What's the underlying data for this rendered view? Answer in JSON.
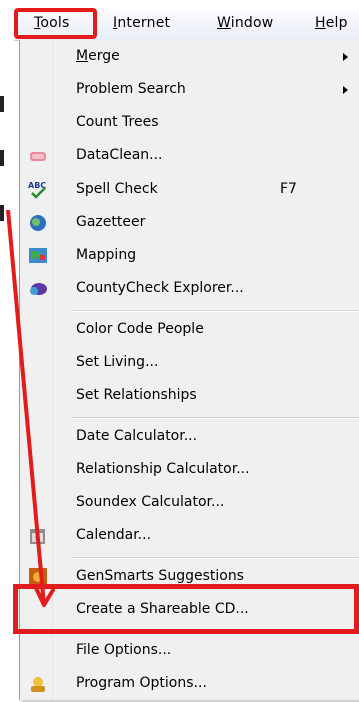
{
  "menubar": {
    "items": [
      {
        "label": "Tools",
        "accel": "T",
        "rest": "ools"
      },
      {
        "label": "Internet",
        "accel": "I",
        "rest": "nternet"
      },
      {
        "label": "Window",
        "accel": "W",
        "rest": "indow"
      },
      {
        "label": "Help",
        "accel": "H",
        "rest": "elp"
      }
    ]
  },
  "tools_menu": {
    "items": [
      {
        "label": "Merge",
        "accel": "M",
        "rest": "erge",
        "submenu": true
      },
      {
        "label": "Problem Search",
        "submenu": true
      },
      {
        "label": "Count Trees"
      },
      {
        "label": "DataClean...",
        "icon": "dataclean-icon"
      },
      {
        "label": "Spell Check",
        "shortcut": "F7",
        "icon": "spell-check-icon"
      },
      {
        "label": "Gazetteer",
        "icon": "gazetteer-icon"
      },
      {
        "label": "Mapping",
        "icon": "mapping-icon"
      },
      {
        "label": "CountyCheck Explorer...",
        "icon": "countycheck-icon"
      },
      {
        "label": "Color Code People"
      },
      {
        "label": "Set Living..."
      },
      {
        "label": "Set Relationships"
      },
      {
        "label": "Date Calculator..."
      },
      {
        "label": "Relationship Calculator..."
      },
      {
        "label": "Soundex Calculator..."
      },
      {
        "label": "Calendar...",
        "icon": "calendar-icon"
      },
      {
        "label": "GenSmarts Suggestions",
        "icon": "gensmarts-icon"
      },
      {
        "label": "Create a Shareable CD..."
      },
      {
        "label": "File Options..."
      },
      {
        "label": "Program Options...",
        "icon": "program-options-icon"
      }
    ]
  },
  "annotation": {
    "color": "#e41b1b"
  }
}
